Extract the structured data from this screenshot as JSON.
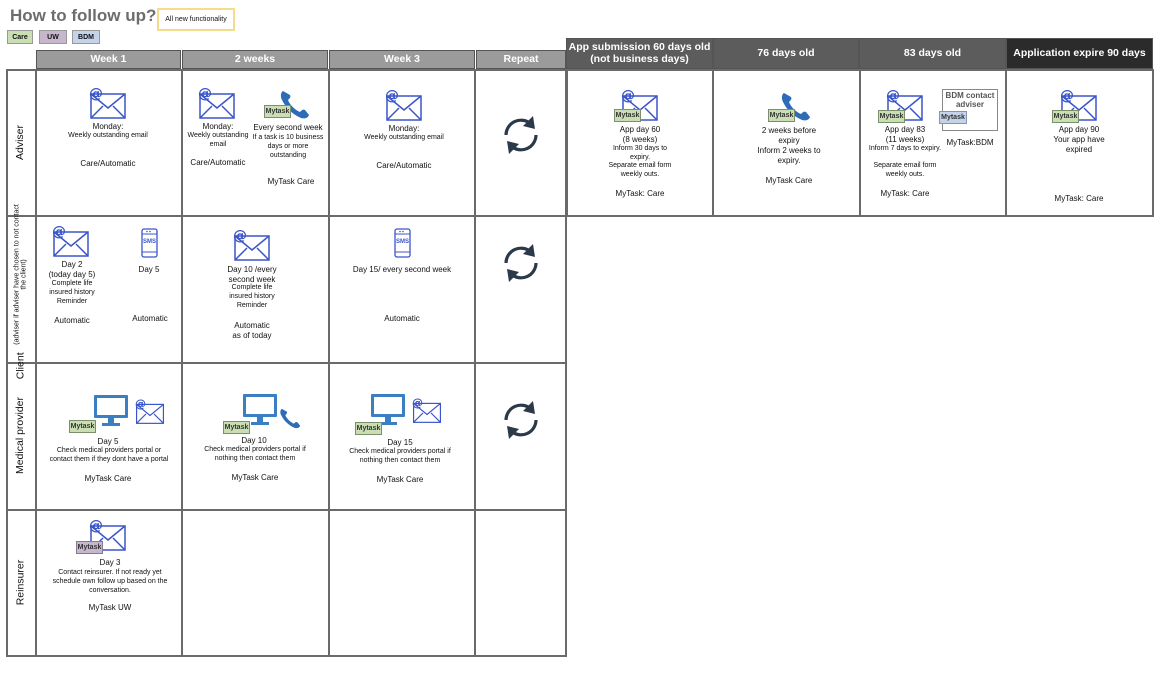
{
  "page": {
    "title": "How to follow up?",
    "note": "All new functionality"
  },
  "legend": {
    "care": "Care",
    "uw": "UW",
    "bdm": "BDM"
  },
  "headers": {
    "week1": "Week 1",
    "weeks2": "2 weeks",
    "week3": "Week 3",
    "repeat": "Repeat",
    "d60": "App submission 60 days old (not business days)",
    "d76": "76 days old",
    "d83": "83 days old",
    "d90": "Application expire 90 days"
  },
  "rows": {
    "adviser": "Adviser",
    "client_main": "Client",
    "client_sub": "(adviser if adviser have chosen to not contact the client)",
    "medical": "Medical provider",
    "reinsurer": "Reinsurer"
  },
  "tags": {
    "mytask": "Mytask",
    "sms": "SMS",
    "bdm_contact": "BDM contact adviser"
  },
  "adviser": {
    "w1": {
      "line1": "Monday:",
      "line2": "Weekly outstanding email",
      "foot": "Care/Automatic"
    },
    "w2": {
      "line1": "Monday:",
      "line2": "Weekly outstanding email",
      "foot": "Care/Automatic",
      "sec1": "Every second week",
      "sec2": "If a task is 10 business days or more outstanding",
      "sec_foot": "MyTask Care"
    },
    "w3": {
      "line1": "Monday:",
      "line2": "Weekly outstanding email",
      "foot": "Care/Automatic"
    },
    "d60": {
      "line1": "App day 60",
      "line2": "(8 weeks)",
      "line3": "Inform 30 days to expiry.",
      "line4": "Separate email form weekly outs.",
      "foot": "MyTask: Care"
    },
    "d76": {
      "line1": "2 weeks before expiry",
      "line2": "Inform 2 weeks to expiry.",
      "foot": "MyTask Care"
    },
    "d83": {
      "line1": "App day 83",
      "line2": "(11 weeks)",
      "line3": "Inform 7 days to expiry.",
      "line4": "Separate email form weekly outs.",
      "foot": "MyTask: Care",
      "bdm_foot": "MyTask:BDM"
    },
    "d90": {
      "line1": "App day 90",
      "line2": "Your app have expired",
      "foot": "MyTask: Care"
    }
  },
  "client": {
    "w1a": {
      "line1": "Day 2",
      "line2": "(today day 5)",
      "line3": "Complete life insured history Reminder",
      "foot": "Automatic"
    },
    "w1b": {
      "line1": "Day 5",
      "foot": "Automatic"
    },
    "w2": {
      "line1": "Day 10 /every second week",
      "line2": "Complete life insured history Reminder",
      "foot1": "Automatic",
      "foot2": "as of today"
    },
    "w3": {
      "line1": "Day 15/ every second week",
      "foot": "Automatic"
    }
  },
  "medical": {
    "w1": {
      "line1": "Day 5",
      "line2": "Check medical providers portal or contact them if they dont have a portal",
      "foot": "MyTask Care"
    },
    "w2": {
      "line1": "Day 10",
      "line2": "Check medical providers portal if nothing then contact them",
      "foot": "MyTask Care"
    },
    "w3": {
      "line1": "Day 15",
      "line2": "Check medical providers portal if nothing then contact them",
      "foot": "MyTask Care"
    }
  },
  "reinsurer": {
    "w1": {
      "line1": "Day 3",
      "line2": "Contact reinsurer. If not ready yet schedule own follow up based on the conversation.",
      "foot": "MyTask UW"
    }
  },
  "colors": {
    "icon_blue": "#3b55c9",
    "monitor_blue": "#3a7fc1",
    "care": "#c9dfb3",
    "uw": "#c7b7cc",
    "bdm": "#c5d3ea",
    "repeat_icon": "#2b3a4a"
  }
}
